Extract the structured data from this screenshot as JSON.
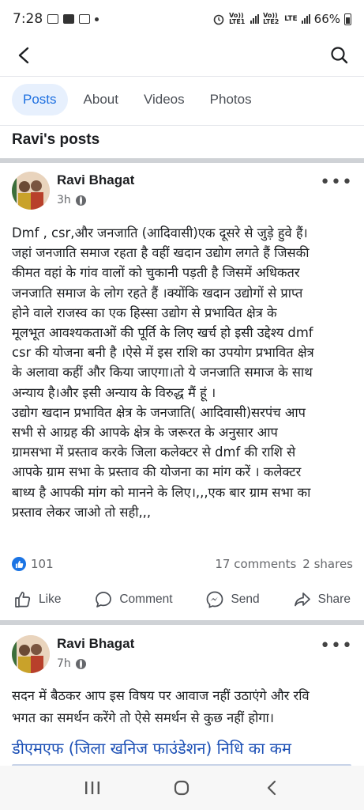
{
  "status_bar": {
    "time": "7:28",
    "sim1": "Vo)) LTE1",
    "sim2": "Vo)) LTE2",
    "network": "LTE",
    "battery": "66%"
  },
  "tabs": [
    {
      "label": "Posts",
      "active": true
    },
    {
      "label": "About",
      "active": false
    },
    {
      "label": "Videos",
      "active": false
    },
    {
      "label": "Photos",
      "active": false
    }
  ],
  "section_title": "Ravi's posts",
  "posts": [
    {
      "author": "Ravi Bhagat",
      "time": "3h",
      "paragraphs": [
        "Dmf , csr,और जनजाति (आदिवासी)एक दूसरे से जुड़े हुवे हैं।",
        "जहां जनजाति समाज रहता है वहीं खदान उद्योग लगते हैं जिसकी",
        "कीमत वहां के गांव वालों को चुकानी पड़ती है जिसमें अधिकतर",
        "जनजाति समाज के लोग रहते हैं ।क्योंकि खदान उद्योगों से प्राप्त",
        "होने वाले राजस्व का एक हिस्सा उद्योग से प्रभावित क्षेत्र के",
        "मूलभूत आवश्यकताओं की पूर्ति के लिए खर्च हो इसी उद्देश्य dmf",
        "csr की योजना बनी है ।ऐसे में इस राशि का उपयोग प्रभावित क्षेत्र",
        "के अलावा कहीं और किया जाएगा।तो ये जनजाति समाज के साथ",
        "अन्याय है।और इसी अन्याय के विरुद्ध मैं हूं ।",
        "उद्योग खदान प्रभावित क्षेत्र के जनजाति( आदिवासी)सरपंच आप",
        "सभी से आग्रह की आपके क्षेत्र के जरूरत के अनुसार आप",
        "ग्रामसभा में प्रस्ताव करके जिला कलेक्टर से dmf की राशि से",
        "आपके ग्राम सभा के प्रस्ताव की योजना का मांग करें । कलेक्टर",
        "बाध्य है आपकी मांग को मानने के लिए।,,,एक बार ग्राम सभा का",
        "प्रस्ताव लेकर जाओ तो सही,,,"
      ],
      "likes": "101",
      "comments": "17 comments",
      "shares": "2 shares"
    },
    {
      "author": "Ravi Bhagat",
      "time": "7h",
      "paragraphs": [
        "सदन में बैठकर आप इस विषय पर आवाज नहीं उठाएंगे और रवि",
        "भगत का समर्थन करेंगे तो ऐसे समर्थन से कुछ नहीं होगा।"
      ],
      "headline": "डीएमएफ (जिला खनिज फाउंडेशन) निधि का कम"
    }
  ],
  "actions": {
    "like": "Like",
    "comment": "Comment",
    "send": "Send",
    "share": "Share"
  }
}
